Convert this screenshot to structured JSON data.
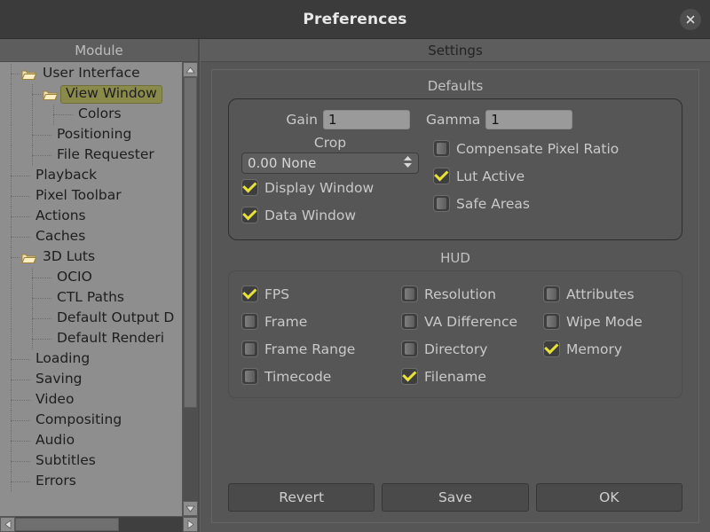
{
  "window": {
    "title": "Preferences",
    "close_icon": "close-icon"
  },
  "module_panel": {
    "header": "Module",
    "tree": [
      {
        "label": "User Interface",
        "depth": 0,
        "folder": true,
        "selected": false
      },
      {
        "label": "View Window",
        "depth": 1,
        "folder": true,
        "selected": true
      },
      {
        "label": "Colors",
        "depth": 2,
        "folder": false,
        "selected": false
      },
      {
        "label": "Positioning",
        "depth": 1,
        "folder": false,
        "selected": false
      },
      {
        "label": "File Requester",
        "depth": 1,
        "folder": false,
        "selected": false
      },
      {
        "label": "Playback",
        "depth": 0,
        "folder": false,
        "selected": false
      },
      {
        "label": "Pixel Toolbar",
        "depth": 0,
        "folder": false,
        "selected": false
      },
      {
        "label": "Actions",
        "depth": 0,
        "folder": false,
        "selected": false
      },
      {
        "label": "Caches",
        "depth": 0,
        "folder": false,
        "selected": false
      },
      {
        "label": "3D Luts",
        "depth": 0,
        "folder": true,
        "selected": false
      },
      {
        "label": "OCIO",
        "depth": 1,
        "folder": false,
        "selected": false
      },
      {
        "label": "CTL Paths",
        "depth": 1,
        "folder": false,
        "selected": false
      },
      {
        "label": "Default Output D",
        "depth": 1,
        "folder": false,
        "selected": false
      },
      {
        "label": "Default Renderi",
        "depth": 1,
        "folder": false,
        "selected": false
      },
      {
        "label": "Loading",
        "depth": 0,
        "folder": false,
        "selected": false
      },
      {
        "label": "Saving",
        "depth": 0,
        "folder": false,
        "selected": false
      },
      {
        "label": "Video",
        "depth": 0,
        "folder": false,
        "selected": false
      },
      {
        "label": "Compositing",
        "depth": 0,
        "folder": false,
        "selected": false
      },
      {
        "label": "Audio",
        "depth": 0,
        "folder": false,
        "selected": false
      },
      {
        "label": "Subtitles",
        "depth": 0,
        "folder": false,
        "selected": false
      },
      {
        "label": "Errors",
        "depth": 0,
        "folder": false,
        "selected": false
      }
    ]
  },
  "settings_panel": {
    "header": "Settings",
    "defaults": {
      "title": "Defaults",
      "gain": {
        "label": "Gain",
        "value": "1",
        "placeholder": ""
      },
      "gamma": {
        "label": "Gamma",
        "value": "1",
        "placeholder": ""
      },
      "crop": {
        "label": "Crop",
        "value": "0.00 None"
      },
      "checkboxes": [
        {
          "label": "Display Window",
          "checked": true
        },
        {
          "label": "Data Window",
          "checked": true
        },
        {
          "label": "Compensate Pixel Ratio",
          "checked": false
        },
        {
          "label": "Lut Active",
          "checked": true
        },
        {
          "label": "Safe Areas",
          "checked": false
        }
      ]
    },
    "hud": {
      "title": "HUD",
      "items": [
        {
          "label": "FPS",
          "checked": true
        },
        {
          "label": "Resolution",
          "checked": false
        },
        {
          "label": "Attributes",
          "checked": false
        },
        {
          "label": "Frame",
          "checked": false
        },
        {
          "label": "VA Difference",
          "checked": false
        },
        {
          "label": "Wipe Mode",
          "checked": false
        },
        {
          "label": "Frame Range",
          "checked": false
        },
        {
          "label": "Directory",
          "checked": false
        },
        {
          "label": "Memory",
          "checked": true
        },
        {
          "label": "Timecode",
          "checked": false
        },
        {
          "label": "Filename",
          "checked": true
        },
        {
          "label": "",
          "checked": false
        }
      ]
    },
    "buttons": {
      "revert": "Revert",
      "save": "Save",
      "ok": "OK"
    }
  },
  "colors": {
    "accent_selected": "#8a8a4a",
    "check_mark": "#e8e13a",
    "panel_bg": "#565656",
    "tree_bg": "#8e8e8e",
    "titlebar_bg": "#3b3b3b"
  }
}
